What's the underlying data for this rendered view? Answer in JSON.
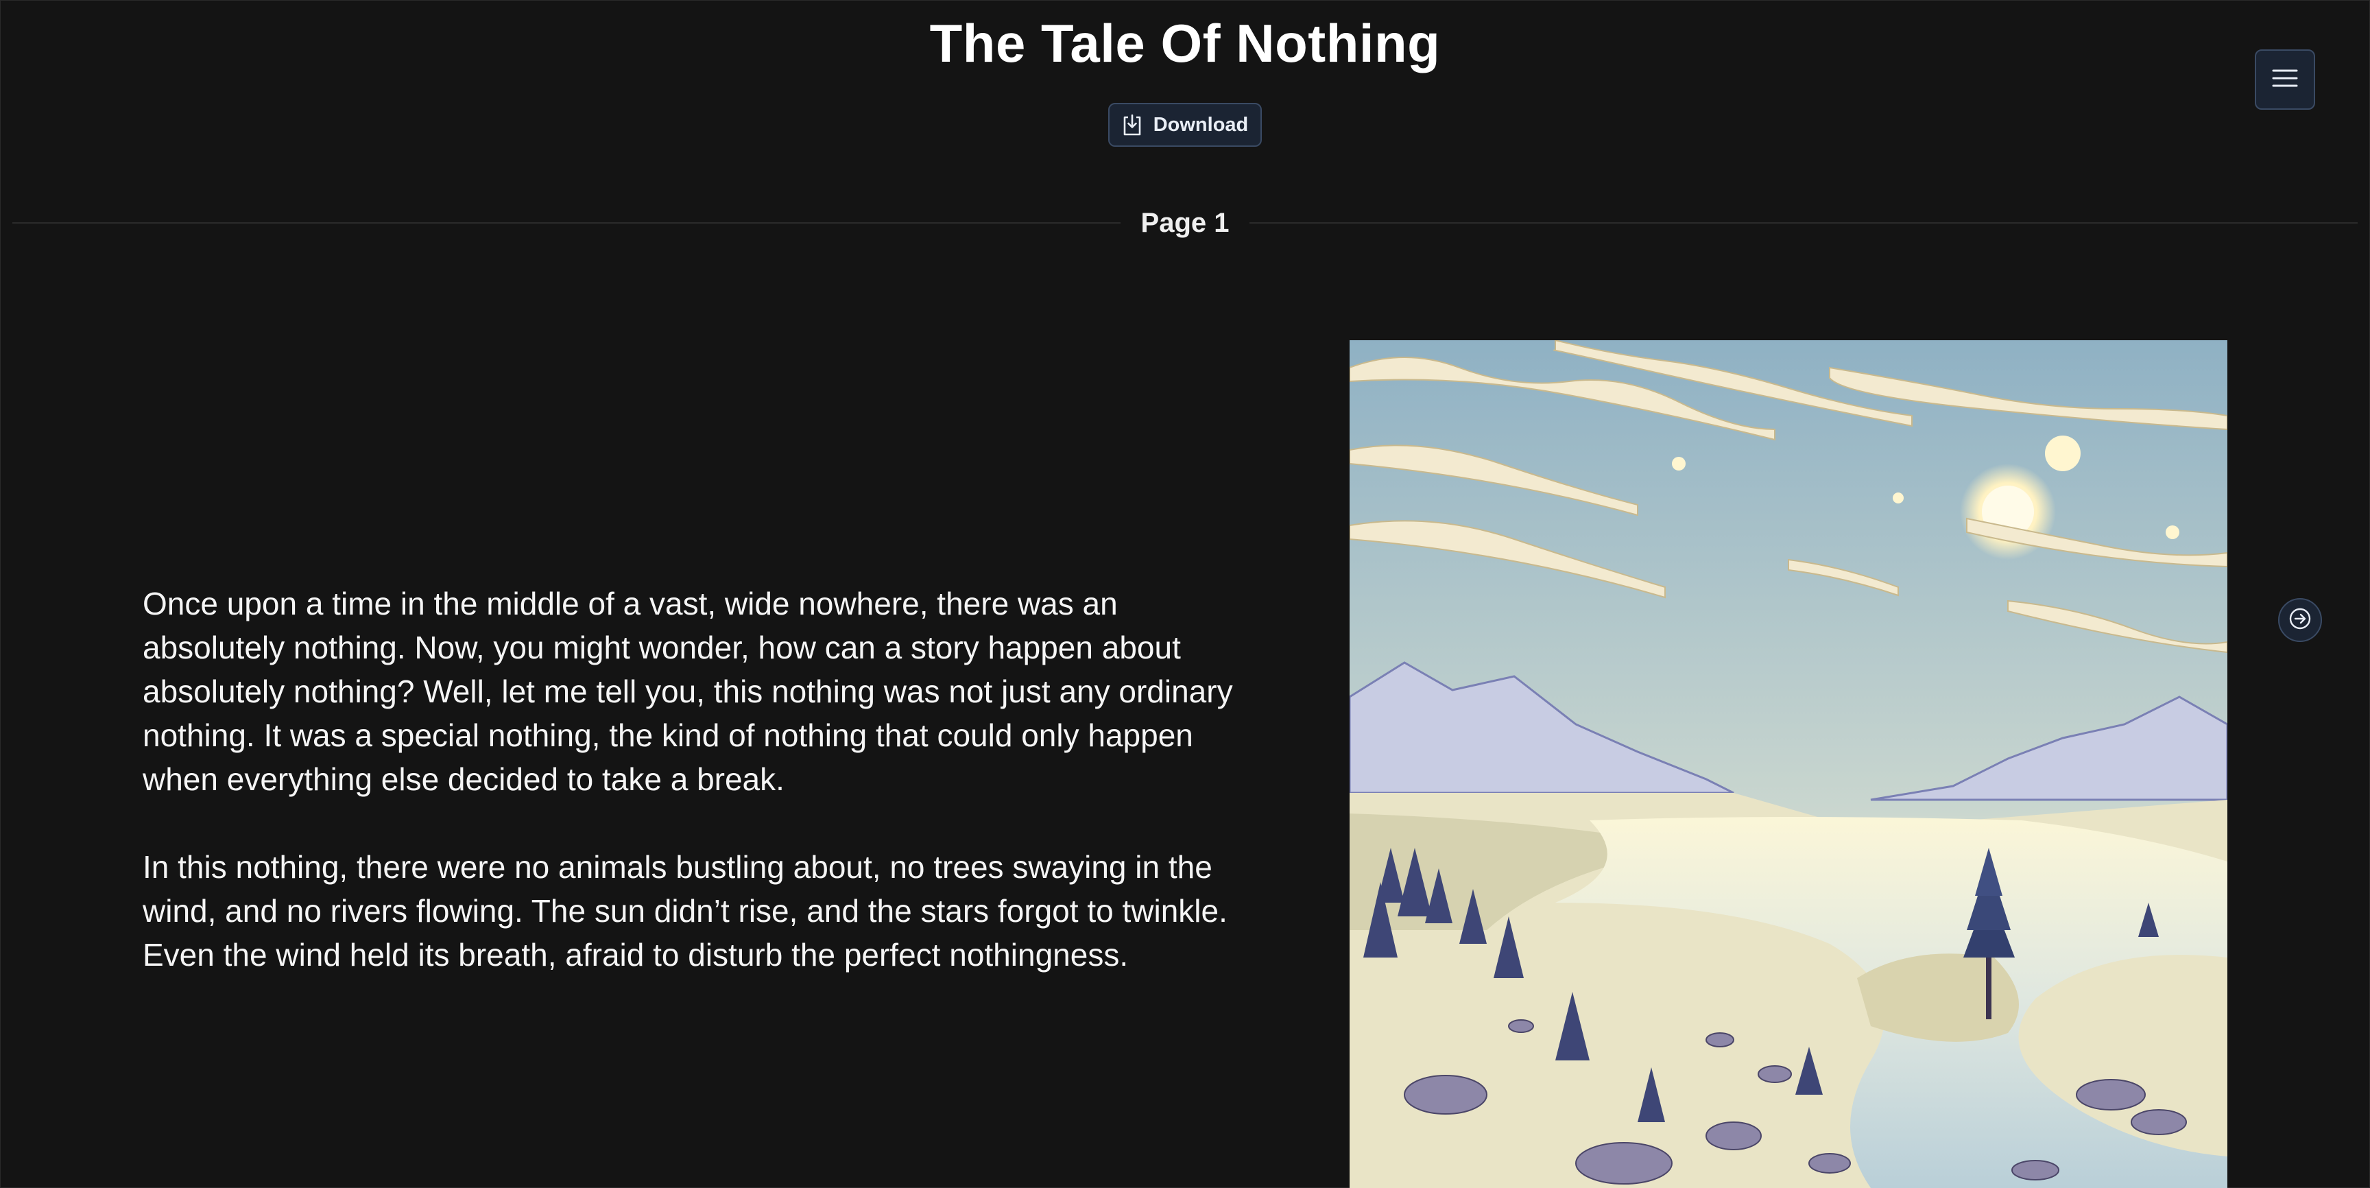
{
  "story": {
    "title": "The Tale Of Nothing",
    "page_label": "Page 1",
    "paragraphs": [
      "Once upon a time in the middle of a vast, wide nowhere, there was an absolutely nothing. Now, you might wonder, how can a story happen about absolutely nothing? Well, let me tell you, this nothing was not just any ordinary nothing. It was a special nothing, the kind of nothing that could only happen when everything else decided to take a break.",
      "In this nothing, there were no animals bustling about, no trees swaying in the wind, and no rivers flowing. The sun didn’t rise, and the stars forgot to twinkle. Even the wind held its breath, afraid to disturb the perfect nothingness."
    ]
  },
  "toolbar": {
    "download_label": "Download",
    "download_icon": "download-icon",
    "menu_icon": "hamburger-menu-icon"
  },
  "navigation": {
    "next_icon": "arrow-right-icon"
  },
  "colors": {
    "background": "#141414",
    "button_bg": "#1b2433",
    "button_border": "#3a4a63",
    "text": "#f5f5f5"
  }
}
